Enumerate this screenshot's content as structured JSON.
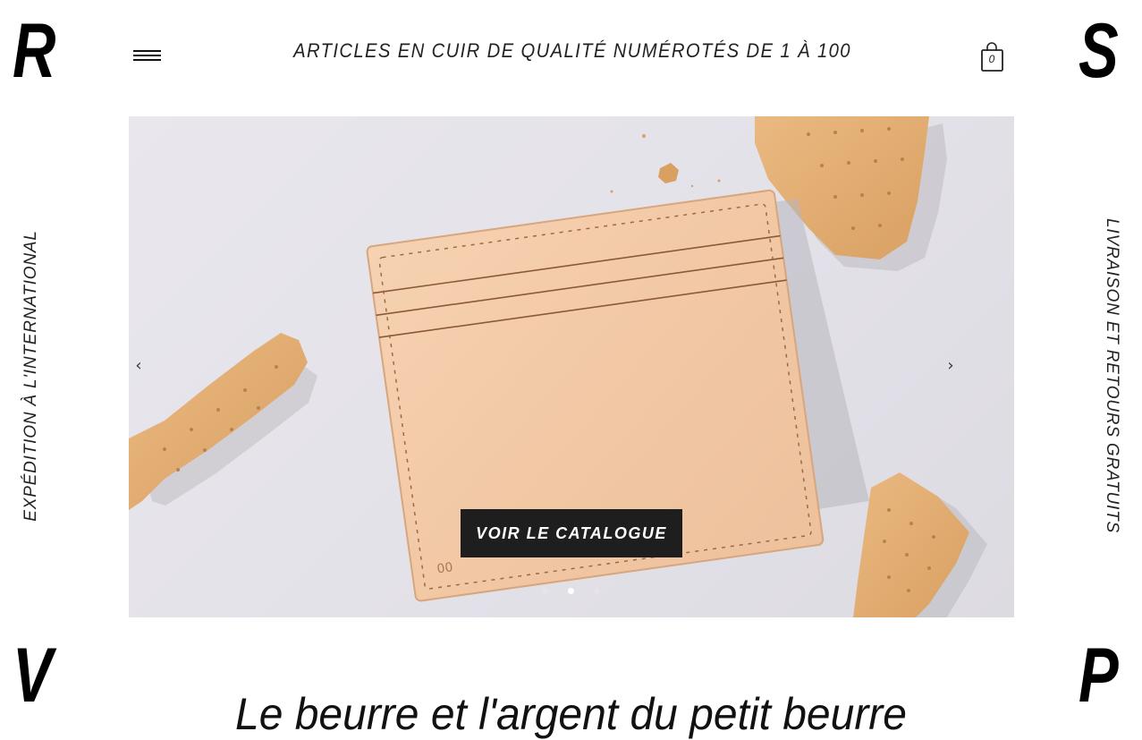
{
  "brand": {
    "corners": [
      "R",
      "S",
      "V",
      "P"
    ]
  },
  "header": {
    "tagline": "ARTICLES EN CUIR DE QUALITÉ NUMÉROTÉS DE 1 À 100",
    "cart_count": "0",
    "menu_icon": "hamburger-icon",
    "cart_icon": "shopping-bag-icon"
  },
  "side": {
    "left": "EXPÉDITION À L'INTERNATIONAL",
    "right": "LIVRAISON ET RETOURS GRATUITS"
  },
  "slider": {
    "prev": "‹",
    "next": "›",
    "cta": "VOIR LE CATALOGUE",
    "slide_count": 3,
    "active_slide": 2,
    "image": "leather-card-holder-with-biscuits"
  },
  "main": {
    "headline": "Le beurre et l'argent du petit beurre"
  },
  "colors": {
    "cta_background": "#1e1e1e",
    "text": "#111111",
    "background": "#ffffff"
  }
}
